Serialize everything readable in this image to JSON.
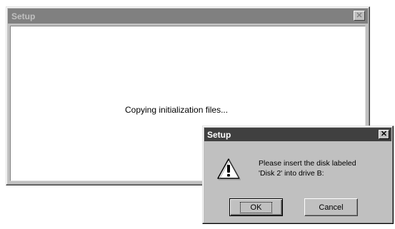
{
  "background_window": {
    "title": "Setup",
    "close_glyph": "✕",
    "status_text": "Copying initialization files..."
  },
  "dialog": {
    "title": "Setup",
    "close_glyph": "✕",
    "icon": "warning-icon",
    "message_line1": "Please insert the disk labeled",
    "message_line2": "'Disk 2' into drive B:",
    "ok_label": "OK",
    "cancel_label": "Cancel"
  },
  "colors": {
    "window_face": "#c0c0c0",
    "active_titlebar": "#404040",
    "inactive_titlebar": "#808080",
    "client_background": "#ffffff"
  }
}
